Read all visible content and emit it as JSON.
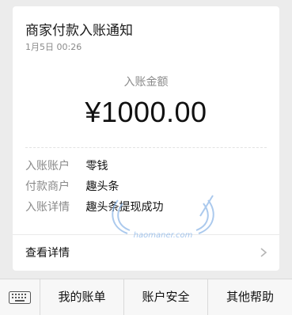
{
  "notification": {
    "title": "商家付款入账通知",
    "time": "1月5日  00:26",
    "amount_label": "入账金额",
    "amount": "¥1000.00",
    "rows": [
      {
        "key": "入账账户",
        "value": "零钱"
      },
      {
        "key": "付款商户",
        "value": "趣头条"
      },
      {
        "key": "入账详情",
        "value": "趣头条提现成功"
      }
    ],
    "detail_link": "查看详情"
  },
  "bottom_menu": {
    "keyboard_icon": "keyboard-icon",
    "items": [
      "我的账单",
      "账户安全",
      "其他帮助"
    ]
  },
  "watermark": {
    "text": "haomaner.com"
  },
  "colors": {
    "background": "#ececec",
    "card": "#ffffff",
    "muted_text": "#8a8a8a",
    "primary_text": "#111111",
    "watermark": "#8fb8e8"
  }
}
